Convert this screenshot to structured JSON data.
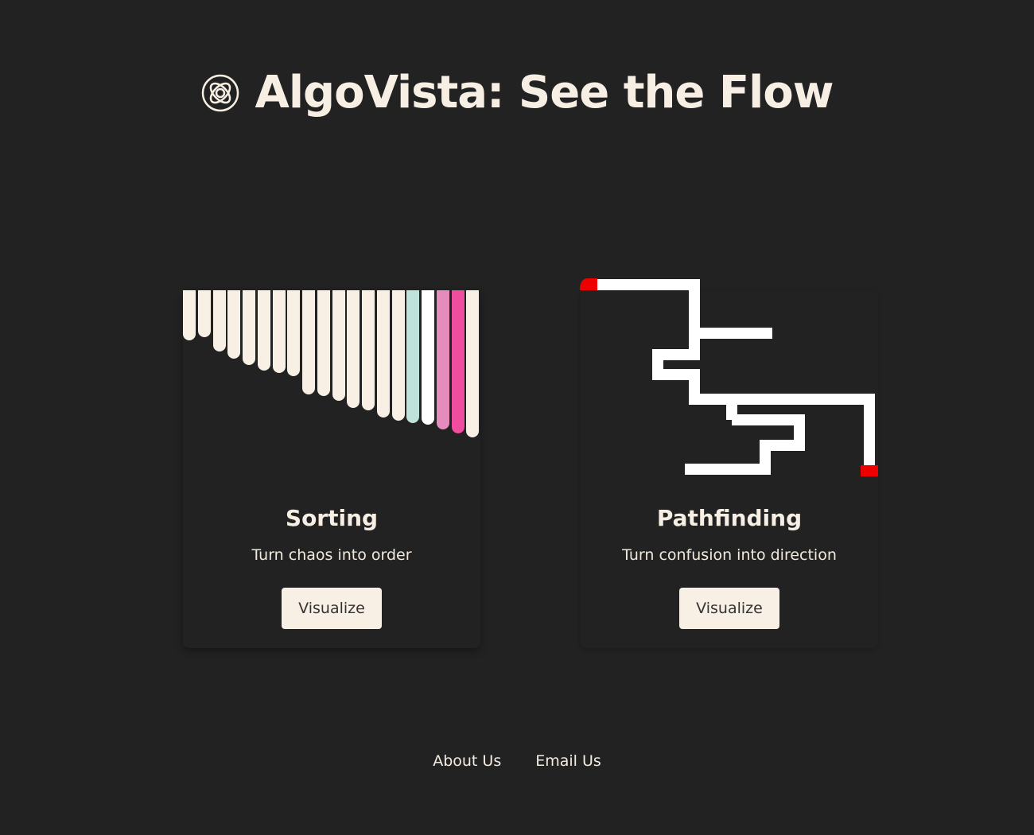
{
  "header": {
    "title": "AlgoVista: See the Flow",
    "logo_icon": "knot-logo-icon"
  },
  "cards": [
    {
      "title": "Sorting",
      "subtitle": "Turn chaos into order",
      "button_label": "Visualize"
    },
    {
      "title": "Pathfinding",
      "subtitle": "Turn confusion into direction",
      "button_label": "Visualize"
    }
  ],
  "sorting_bars": {
    "relative_heights": [
      0.35,
      0.33,
      0.43,
      0.48,
      0.52,
      0.56,
      0.58,
      0.6,
      0.73,
      0.74,
      0.77,
      0.82,
      0.84,
      0.89,
      0.91,
      0.93,
      0.94,
      0.97,
      1.0,
      1.03
    ],
    "highlights": {
      "15": "#bfe3da",
      "16": "#ffffff",
      "17": "#e58cbd",
      "18": "#f04d9f"
    },
    "default_color": "#f8efe5"
  },
  "maze": {
    "path_color": "#ffffff",
    "endpoint_color": "#ee0000"
  },
  "footer": {
    "links": [
      "About Us",
      "Email Us"
    ]
  }
}
